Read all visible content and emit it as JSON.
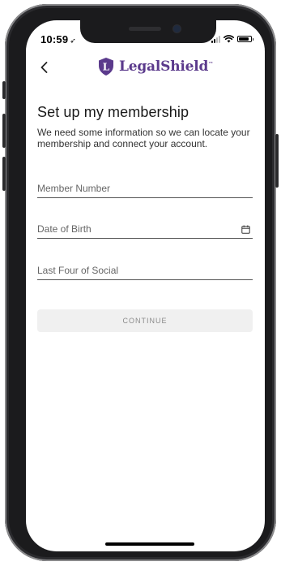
{
  "status_bar": {
    "time": "10:59",
    "location_arrow": "➶"
  },
  "header": {
    "back_icon": "chevron-left-icon",
    "logo_text": "LegalShield",
    "logo_tm": "™",
    "logo_mark_letter": "L"
  },
  "main": {
    "title": "Set up my membership",
    "subtitle": "We need some information so we can locate your membership and connect your account.",
    "fields": [
      {
        "placeholder": "Member Number"
      },
      {
        "placeholder": "Date of Birth",
        "icon": "calendar-icon"
      },
      {
        "placeholder": "Last Four of Social"
      }
    ],
    "continue_label": "CONTINUE"
  },
  "colors": {
    "brand_purple": "#5b3a8c",
    "button_bg": "#f0f0f0",
    "button_text": "#8a8a8a"
  }
}
